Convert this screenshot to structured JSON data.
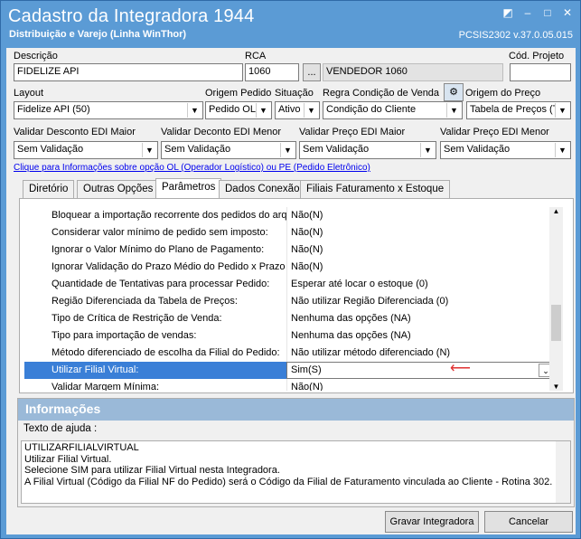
{
  "window": {
    "title": "Cadastro da Integradora 1944",
    "subtitle": "Distribuição e Varejo (Linha WinThor)",
    "version": "PCSIS2302  v.37.0.05.015",
    "controls": [
      "◩",
      "–",
      "□",
      "✕"
    ]
  },
  "form": {
    "descricao_label": "Descrição",
    "descricao_value": "FIDELIZE API",
    "rca_label": "RCA",
    "rca_value": "1060",
    "rca_lookup": "...",
    "rca_name": "VENDEDOR 1060",
    "cod_projeto_label": "Cód. Projeto",
    "cod_projeto_value": "",
    "layout_label": "Layout",
    "layout_value": "Fidelize API (50)",
    "origem_pedido_label": "Origem Pedido",
    "origem_pedido_value": "Pedido OL",
    "situacao_label": "Situação",
    "situacao_value": "Ativo",
    "regra_label": "Regra Condição de Venda",
    "regra_value": "Condição do Cliente",
    "origem_preco_label": "Origem do Preço",
    "origem_preco_value": "Tabela de Preços (T",
    "vd_edi_maior_label": "Validar Desconto EDI Maior",
    "vd_edi_maior_value": "Sem Validação",
    "vd_edi_menor_label": "Validar Deconto EDI Menor",
    "vd_edi_menor_value": "Sem Validação",
    "vp_edi_maior_label": "Validar Preço EDI Maior",
    "vp_edi_maior_value": "Sem Validação",
    "vp_edi_menor_label": "Validar Preço EDI Menor",
    "vp_edi_menor_value": "Sem Validação",
    "info_link": "Clique para Informações sobre opção OL (Operador Logístico) ou PE (Pedido Eletrônico)"
  },
  "tabs": [
    "Diretório",
    "Outras Opções",
    "Parâmetros",
    "Dados Conexão",
    "Filiais Faturamento x Estoque"
  ],
  "params": [
    {
      "k": "Bloquear a importação recorrente dos pedidos do arquivo",
      "v": "Não(N)"
    },
    {
      "k": "Considerar valor mínimo de pedido sem imposto:",
      "v": "Não(N)"
    },
    {
      "k": "Ignorar o Valor Mínimo do Plano de Pagamento:",
      "v": "Não(N)"
    },
    {
      "k": "Ignorar Validação do Prazo Médio do Pedido x Prazo Médio",
      "v": "Não(N)"
    },
    {
      "k": "Quantidade de Tentativas para processar Pedido:",
      "v": "Esperar até locar o estoque (0)"
    },
    {
      "k": "Região Diferenciada da Tabela de Preços:",
      "v": "Não utilizar Região Diferenciada (0)"
    },
    {
      "k": "Tipo de Crítica de Restrição de Venda:",
      "v": "Nenhuma das opções (NA)"
    },
    {
      "k": "Tipo para importação de vendas:",
      "v": "Nenhuma das opções (NA)"
    },
    {
      "k": "Método diferenciado de escolha da Filial do Pedido:",
      "v": "Não utilizar método diferenciado (N)"
    },
    {
      "k": "Utilizar Filial Virtual:",
      "v": "Sim(S)"
    },
    {
      "k": "Validar Margem Mínima:",
      "v": "Não(N)"
    }
  ],
  "info": {
    "header": "Informações",
    "help_label": "Texto de ajuda :",
    "help_text": "UTILIZARFILIALVIRTUAL\nUtilizar Filial Virtual.\nSelecione SIM para utilizar Filial Virtual nesta Integradora.\nA Filial Virtual (Código da Filial NF do Pedido) será o Código da Filial de Faturamento vinculada ao Cliente - Rotina 302."
  },
  "buttons": {
    "gravar": "Gravar Integradora",
    "cancelar": "Cancelar"
  },
  "colors": {
    "titlebar": "#5b9bd5",
    "selection": "#3a7fd7",
    "arrow": "#e03030"
  }
}
